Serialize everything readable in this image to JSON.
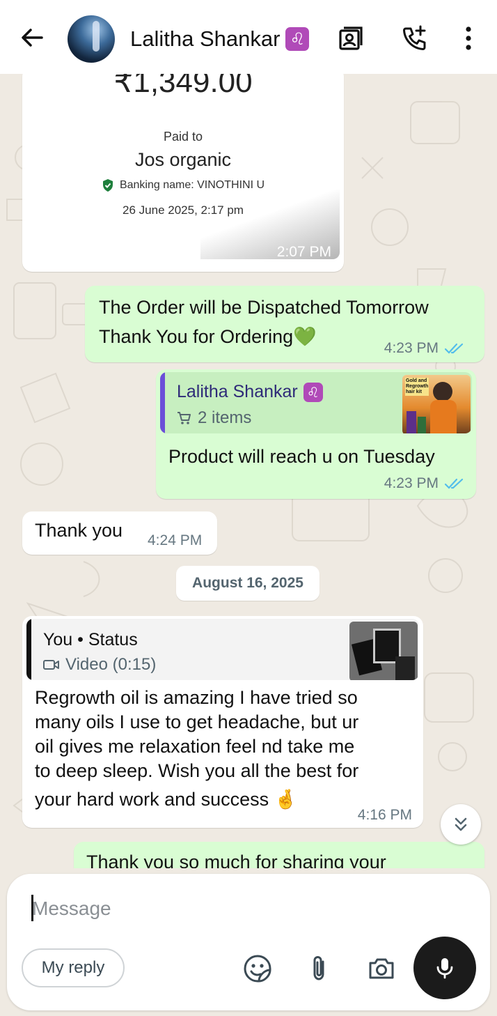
{
  "header": {
    "contact_name": "Lalitha Shankar",
    "zodiac_emoji": "♌",
    "icons": [
      "back-arrow-icon",
      "avatar",
      "contact-card-icon",
      "add-call-icon",
      "more-vertical-icon"
    ]
  },
  "payment_card": {
    "amount": "₹1,349.00",
    "paid_to_label": "Paid to",
    "payee": "Jos organic",
    "banking_name": "Banking name: VINOTHINI U",
    "date": "26 June 2025, 2:17 pm",
    "time": "2:07 PM"
  },
  "messages": [
    {
      "id": "m1",
      "direction": "out",
      "lines": [
        "The Order will be Dispatched Tomorrow",
        "Thank You for Ordering💚"
      ],
      "time": "4:23 PM",
      "status": "read"
    },
    {
      "id": "m2",
      "direction": "out",
      "reply": {
        "name": "Lalitha Shankar",
        "zodiac": "♌",
        "subtitle": "2 items",
        "thumb_caption": "Gold and Regrowth hair kit"
      },
      "lines": [
        "Product will reach u on Tuesday"
      ],
      "time": "4:23 PM",
      "status": "read"
    },
    {
      "id": "m3",
      "direction": "in",
      "lines": [
        "Thank you"
      ],
      "time": "4:24 PM"
    },
    {
      "id": "m4",
      "direction": "in",
      "reply": {
        "name": "You • Status",
        "subtitle": "Video (0:15)"
      },
      "lines": [
        "Regrowth oil is amazing I have tried so",
        "many oils I use to get headache, but ur",
        "oil gives me relaxation feel nd take me",
        "to deep sleep.  Wish you all the best for",
        "your hard work and success 🤞"
      ],
      "time": "4:16 PM"
    },
    {
      "id": "m5",
      "direction": "out",
      "lines": [
        "Thank you so much for sharing your"
      ]
    }
  ],
  "date_separator": "August 16, 2025",
  "composer": {
    "placeholder": "Message",
    "my_reply_label": "My reply"
  },
  "colors": {
    "outgoing_bubble": "#d9fdd3",
    "incoming_bubble": "#ffffff",
    "chat_background": "#efeae2",
    "read_ticks": "#53bdeb",
    "reply_bar_contact": "#6b4fd8",
    "reply_bar_self": "#111111"
  }
}
